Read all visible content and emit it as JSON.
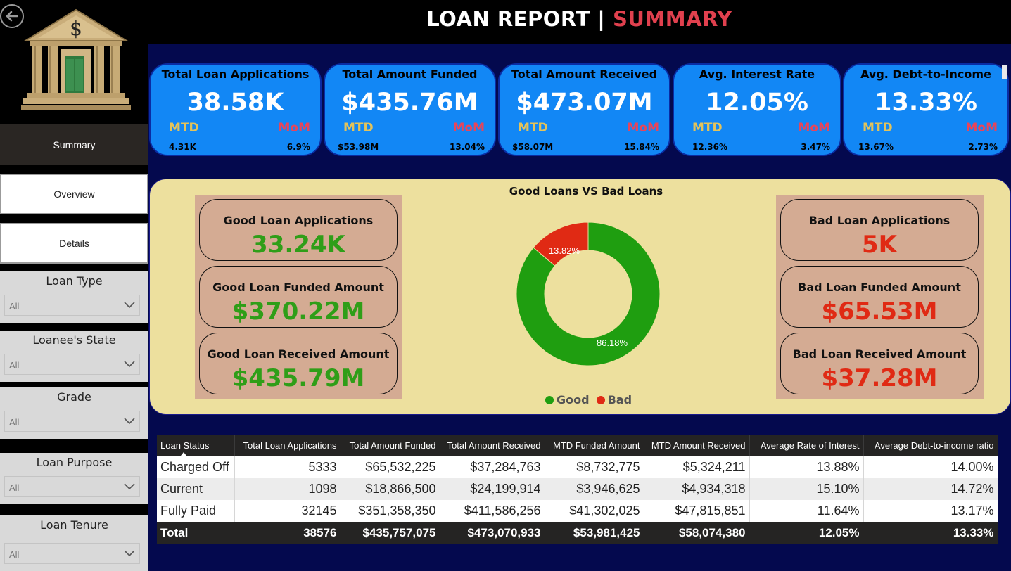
{
  "header": {
    "title_part1": "LOAN REPORT | ",
    "title_part2": "SUMMARY"
  },
  "sidebar": {
    "nav": [
      {
        "label": "Summary"
      },
      {
        "label": "Overview"
      },
      {
        "label": "Details"
      }
    ],
    "slicers": [
      {
        "title": "Loan Type",
        "value": "All"
      },
      {
        "title": "Loanee's State",
        "value": "All"
      },
      {
        "title": "Grade",
        "value": "All"
      },
      {
        "title": "Loan Purpose",
        "value": "All"
      },
      {
        "title": "Loan Tenure",
        "value": "All"
      }
    ]
  },
  "kpis": [
    {
      "title": "Total Loan Applications",
      "value": "38.58K",
      "mtd_label": "MTD",
      "mom_label": "MoM",
      "mtd": "4.31K",
      "mom": "6.9%"
    },
    {
      "title": "Total Amount Funded",
      "value": "$435.76M",
      "mtd_label": "MTD",
      "mom_label": "MoM",
      "mtd": "$53.98M",
      "mom": "13.04%"
    },
    {
      "title": "Total Amount Received",
      "value": "$473.07M",
      "mtd_label": "MTD",
      "mom_label": "MoM",
      "mtd": "$58.07M",
      "mom": "15.84%"
    },
    {
      "title": "Avg. Interest Rate",
      "value": "12.05%",
      "mtd_label": "MTD",
      "mom_label": "MoM",
      "mtd": "12.36%",
      "mom": "3.47%"
    },
    {
      "title": "Avg. Debt-to-Income",
      "value": "13.33%",
      "mtd_label": "MTD",
      "mom_label": "MoM",
      "mtd": "13.67%",
      "mom": "2.73%"
    }
  ],
  "good_bad": {
    "chart_title": "Good Loans VS Bad Loans",
    "good_cards": [
      {
        "title": "Good Loan Applications",
        "value": "33.24K"
      },
      {
        "title": "Good Loan Funded Amount",
        "value": "$370.22M"
      },
      {
        "title": "Good Loan Received Amount",
        "value": "$435.79M"
      }
    ],
    "bad_cards": [
      {
        "title": "Bad Loan Applications",
        "value": "5K"
      },
      {
        "title": "Bad Loan Funded Amount",
        "value": "$65.53M"
      },
      {
        "title": "Bad Loan Received Amount",
        "value": "$37.28M"
      }
    ]
  },
  "chart_data": {
    "type": "pie",
    "title": "Good Loans VS Bad Loans",
    "categories": [
      "Good",
      "Bad"
    ],
    "values": [
      86.18,
      13.82
    ],
    "labels": [
      "86.18%",
      "13.82%"
    ],
    "colors": [
      "#1f9e10",
      "#e02a14"
    ],
    "legend_position": "bottom"
  },
  "table": {
    "headers": [
      "Loan Status",
      "Total Loan Applications",
      "Total Amount Funded",
      "Total Amount Received",
      "MTD Funded Amount",
      "MTD Amount Received",
      "Average Rate of Interest",
      "Average Debt-to-income ratio"
    ],
    "rows": [
      [
        "Charged Off",
        "5333",
        "$65,532,225",
        "$37,284,763",
        "$8,732,775",
        "$5,324,211",
        "13.88%",
        "14.00%"
      ],
      [
        "Current",
        "1098",
        "$18,866,500",
        "$24,199,914",
        "$3,946,625",
        "$4,934,318",
        "15.10%",
        "14.72%"
      ],
      [
        "Fully Paid",
        "32145",
        "$351,358,350",
        "$411,586,256",
        "$41,302,025",
        "$47,815,851",
        "11.64%",
        "13.17%"
      ]
    ],
    "total": [
      "Total",
      "38576",
      "$435,757,075",
      "$473,070,933",
      "$53,981,425",
      "$58,074,380",
      "12.05%",
      "13.33%"
    ]
  }
}
